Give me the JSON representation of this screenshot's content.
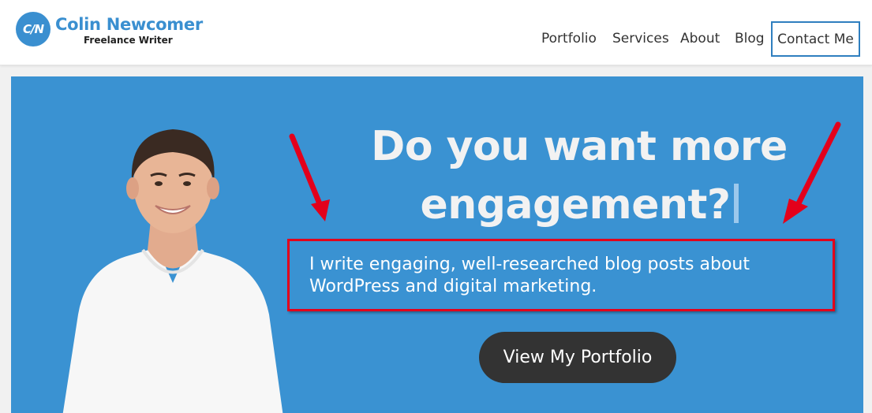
{
  "logo": {
    "badge": "C/N",
    "name": "Colin Newcomer",
    "tagline": "Freelance Writer"
  },
  "nav": {
    "items": [
      "Portfolio",
      "Services",
      "About",
      "Blog"
    ],
    "contact": "Contact Me"
  },
  "hero": {
    "headline_line1": "Do you want more",
    "headline_line2": "engagement?",
    "subtitle": "I write engaging, well-researched blog posts about WordPress and digital marketing.",
    "cta": "View My Portfolio"
  },
  "colors": {
    "brand_blue": "#3a8fd0",
    "hero_bg": "#3a92d2",
    "annotation_red": "#e3001b",
    "cta_bg": "#333333"
  }
}
